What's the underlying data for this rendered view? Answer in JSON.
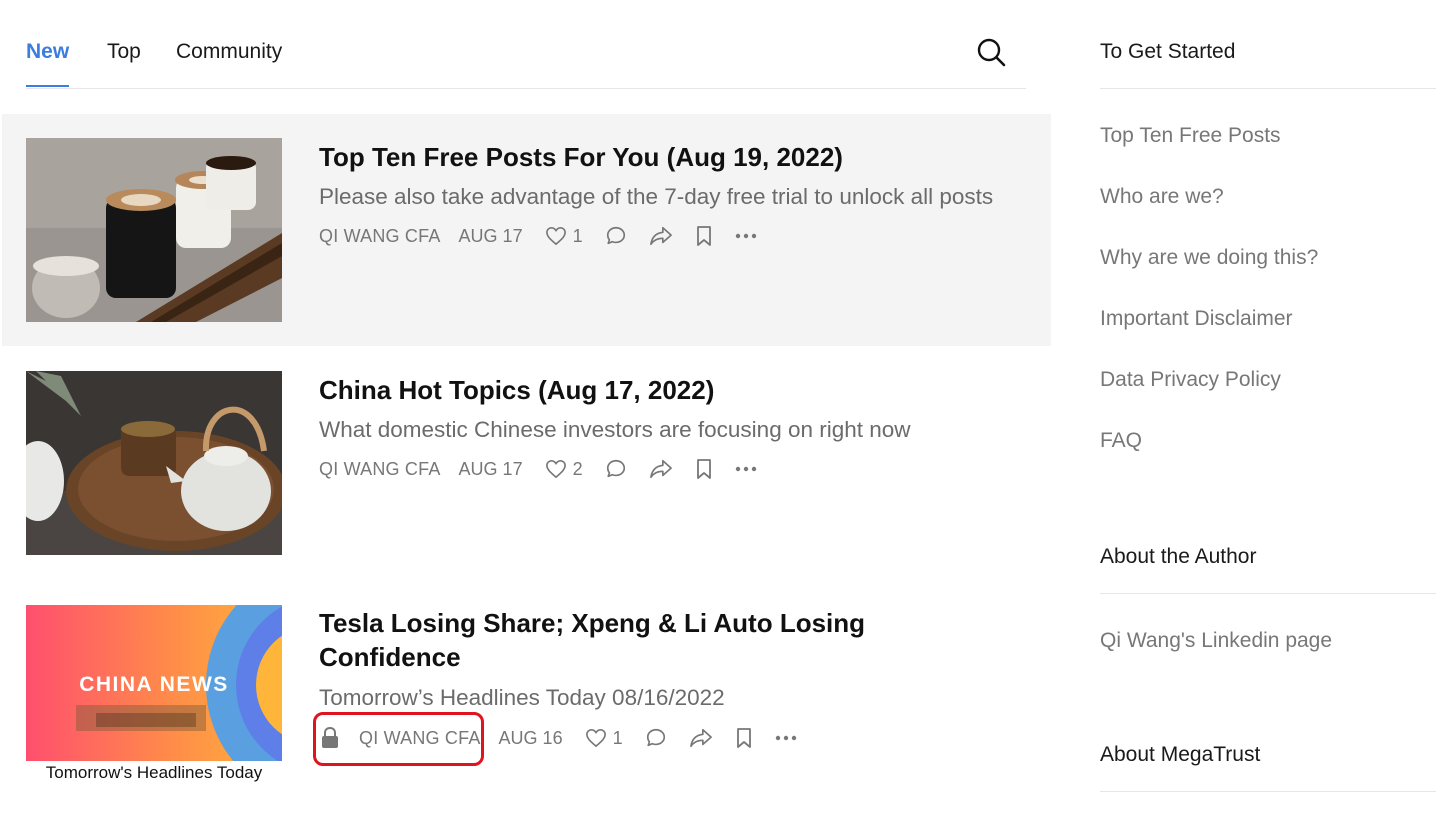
{
  "tabs": [
    {
      "label": "New",
      "active": true
    },
    {
      "label": "Top",
      "active": false
    },
    {
      "label": "Community",
      "active": false
    }
  ],
  "search": {
    "icon": "search-icon"
  },
  "posts": [
    {
      "title": "Top Ten Free Posts For You (Aug 19, 2022)",
      "subtitle": "Please also take advantage of the 7-day free trial to unlock all posts",
      "author": "QI WANG CFA",
      "date": "AUG 17",
      "likes": "1",
      "locked": false
    },
    {
      "title": "China Hot Topics (Aug 17, 2022)",
      "subtitle": "What domestic Chinese investors are focusing on right now",
      "author": "QI WANG CFA",
      "date": "AUG 17",
      "likes": "2",
      "locked": false
    },
    {
      "title": "Tesla Losing Share; Xpeng & Li Auto Losing Confidence",
      "subtitle": "Tomorrow’s Headlines Today 08/16/2022",
      "author": "QI WANG CFA",
      "date": "AUG 16",
      "likes": "1",
      "locked": true,
      "thumb_text": "CHINA NEWS",
      "thumb_caption": "Tomorrow's Headlines Today"
    }
  ],
  "sidebar": {
    "getting_started": {
      "heading": "To Get Started",
      "links": [
        "Top Ten Free Posts",
        "Who are we?",
        "Why are we doing this?",
        "Important Disclaimer",
        "Data Privacy Policy",
        "FAQ"
      ]
    },
    "about_author": {
      "heading": "About the Author",
      "links": [
        "Qi Wang's Linkedin page"
      ]
    },
    "about_megatrust": {
      "heading": "About MegaTrust"
    }
  },
  "colors": {
    "accent": "#3d7de0",
    "highlight_box": "#e0141e",
    "muted": "#777777"
  }
}
